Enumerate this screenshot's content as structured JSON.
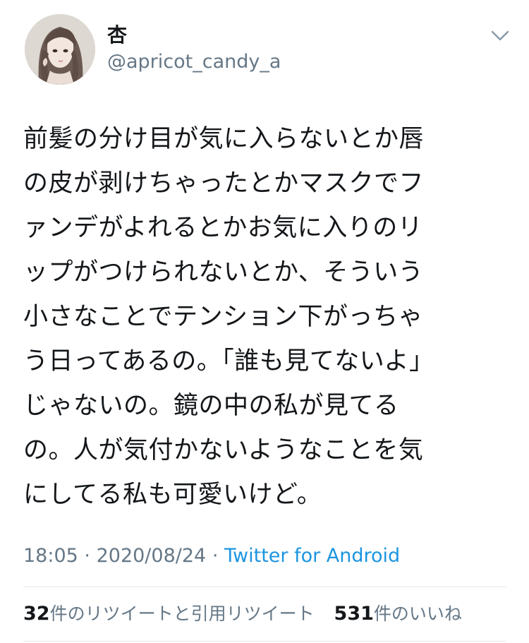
{
  "tweet": {
    "author": {
      "display_name": "杏",
      "handle": "@apricot_candy_a"
    },
    "body_lines": [
      "前髪の分け目が気に入らないとか唇",
      "の皮が剥けちゃったとかマスクでフ",
      "ァンデがよれるとかお気に入りのリ",
      "ップがつけられないとか、そういう",
      "小さなことでテンション下がっちゃ",
      "う日ってあるの。「誰も見てないよ」",
      "じゃないの。鏡の中の私が見てる",
      "の。人が気付かないようなことを気",
      "にしてる私も可愛いけど。"
    ],
    "time": "18:05",
    "separator": "·",
    "date": "2020/08/24",
    "source": "Twitter for Android",
    "retweets": {
      "count": "32",
      "label": "件のリツイートと引用リツイート"
    },
    "likes": {
      "count": "531",
      "label": "件のいいね"
    }
  },
  "icons": {
    "caret": "chevron-down-icon",
    "avatar": "avatar-illustration"
  },
  "colors": {
    "text_primary": "#14171a",
    "text_secondary": "#657786",
    "link": "#1b95e0",
    "divider": "#e1e8ed"
  }
}
